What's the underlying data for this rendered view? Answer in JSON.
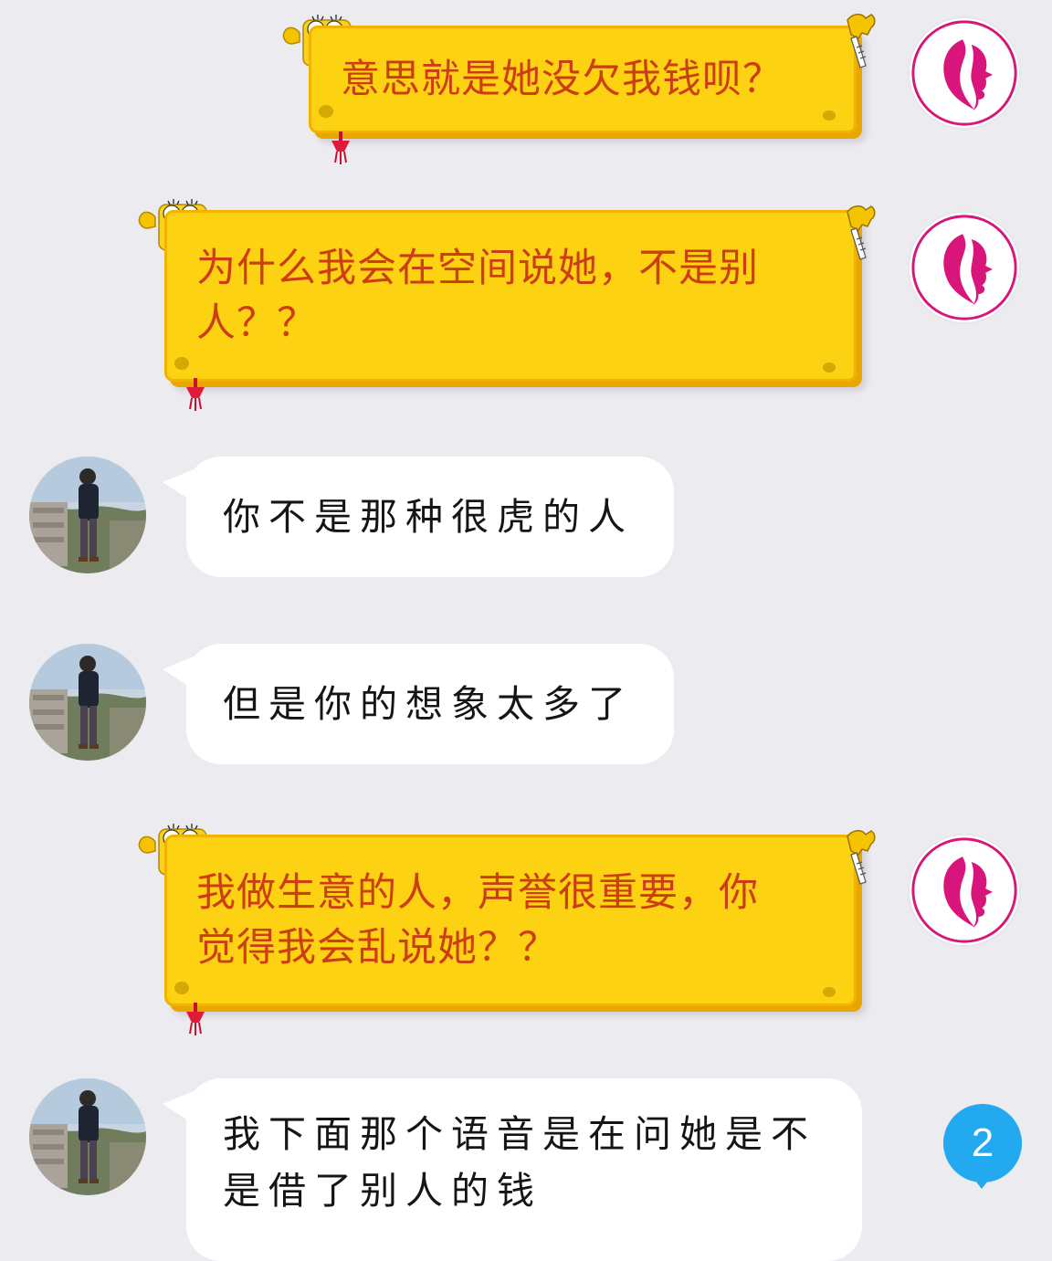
{
  "conversation": {
    "messages": [
      {
        "id": "m1",
        "direction": "outgoing",
        "text": "意思就是她没欠我钱呗？"
      },
      {
        "id": "m2",
        "direction": "outgoing",
        "lines": [
          "为什么我会在空间说她，不是别",
          "人？？"
        ]
      },
      {
        "id": "m3",
        "direction": "incoming",
        "text": "你不是那种很虎的人"
      },
      {
        "id": "m4",
        "direction": "incoming",
        "text": "但是你的想象太多了"
      },
      {
        "id": "m5",
        "direction": "outgoing",
        "lines": [
          "我做生意的人，声誉很重要，你",
          "觉得我会乱说她？？"
        ]
      },
      {
        "id": "m6",
        "direction": "incoming",
        "lines": [
          "我下面那个语音是在问她是不",
          "是借了别人的钱"
        ]
      }
    ]
  },
  "unread_badge": {
    "count": "2",
    "color": "#22a9ef"
  },
  "theme": {
    "outgoing_bubble": "#fcd212",
    "outgoing_text": "#cc3e12",
    "incoming_bubble": "#ffffff",
    "background": "#ebebf0",
    "self_avatar_logo": "#d8157a"
  },
  "icons": {
    "self_avatar": "pink-face-profile-logo",
    "peer_avatar": "person-photo",
    "bubble_decoration": "spongebob-sticker"
  }
}
